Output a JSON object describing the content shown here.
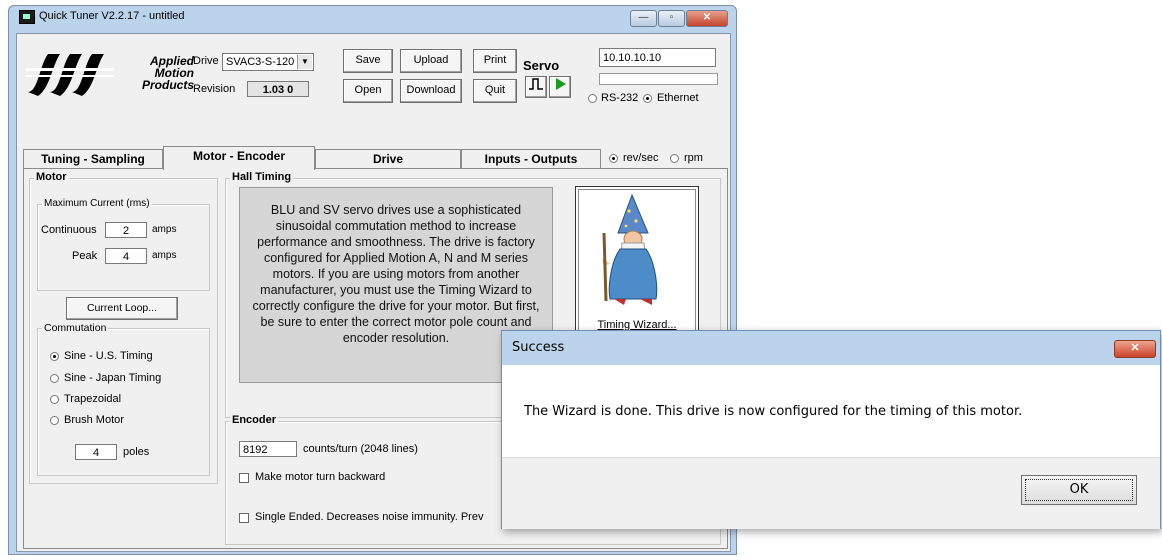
{
  "window": {
    "title": "Quick Tuner  V2.2.17 - untitled",
    "minimize_glyph": "—",
    "maximize_glyph": "▫",
    "close_glyph": "✕"
  },
  "logo": {
    "line1": "Applied",
    "line2": "Motion",
    "line3": "Products"
  },
  "drive": {
    "label": "Drive",
    "selected": "SVAC3-S-120",
    "revision_label": "Revision",
    "revision_value": "1.03 0"
  },
  "toolbar": {
    "save": "Save",
    "upload": "Upload",
    "print": "Print",
    "open": "Open",
    "download": "Download",
    "quit": "Quit"
  },
  "servo": {
    "label": "Servo"
  },
  "connection": {
    "ip": "10.10.10.10",
    "rs232": "RS-232",
    "ethernet": "Ethernet",
    "selected": "Ethernet"
  },
  "tabs": [
    {
      "label": "Tuning - Sampling"
    },
    {
      "label": "Motor - Encoder"
    },
    {
      "label": "Drive"
    },
    {
      "label": "Inputs - Outputs"
    }
  ],
  "active_tab": "Motor - Encoder",
  "units": {
    "revsec": "rev/sec",
    "rpm": "rpm",
    "selected": "rev/sec"
  },
  "motor": {
    "title": "Motor",
    "max_current_title": "Maximum Current (rms)",
    "continuous_label": "Continuous",
    "continuous_value": "2",
    "peak_label": "Peak",
    "peak_value": "4",
    "amps": "amps",
    "current_loop_button": "Current Loop...",
    "commutation_title": "Commutation",
    "commutation_options": [
      "Sine - U.S. Timing",
      "Sine - Japan Timing",
      "Trapezoidal",
      "Brush Motor"
    ],
    "commutation_selected": "Sine - U.S. Timing",
    "poles_value": "4",
    "poles_label": "poles"
  },
  "hall": {
    "title": "Hall Timing",
    "text": "BLU and SV servo drives use a sophisticated sinusoidal commutation method to increase performance and smoothness. The drive is factory configured for Applied Motion A, N and M series motors. If you are using motors from another manufacturer, you must use the Timing Wizard to correctly configure the drive for your motor. But first, be sure to enter the correct motor pole count and encoder resolution.",
    "wizard_label": "Timing Wizard..."
  },
  "encoder": {
    "title": "Encoder",
    "counts_value": "8192",
    "counts_label": "counts/turn (2048 lines)",
    "backward_label": "Make motor turn backward",
    "single_ended_label": "Single Ended. Decreases noise immunity. Prev"
  },
  "dialog": {
    "title": "Success",
    "message": "The Wizard is done.  This drive is now configured for the timing of this motor.",
    "ok": "OK"
  }
}
